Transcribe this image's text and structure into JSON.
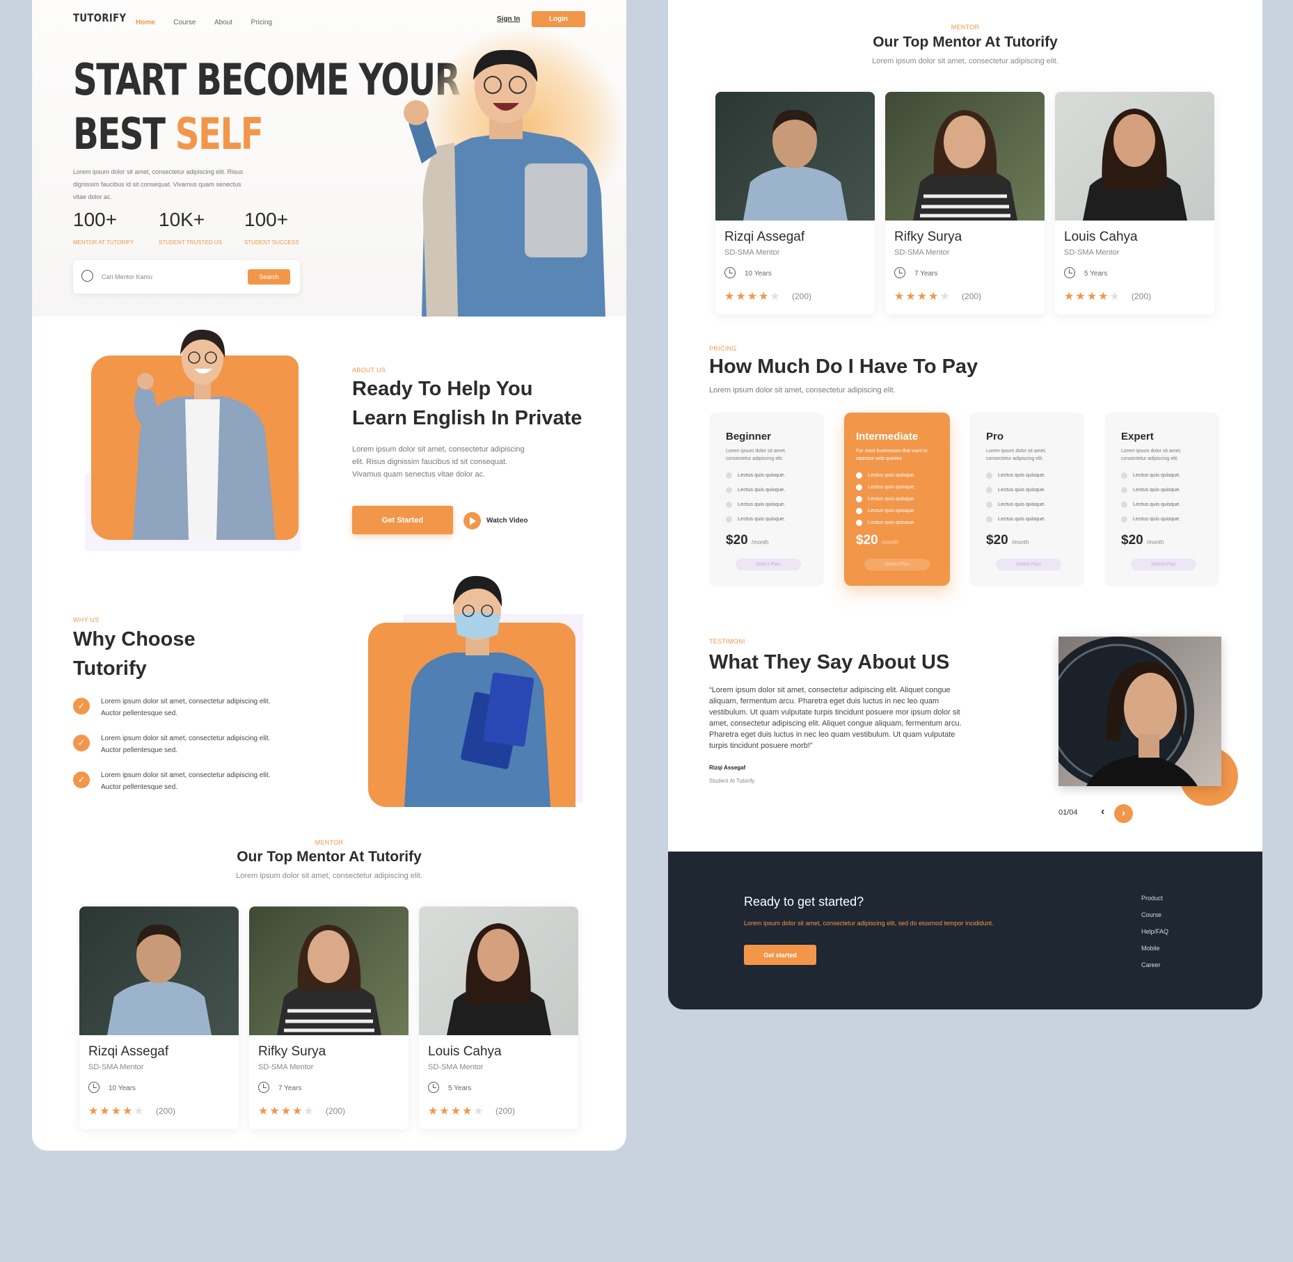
{
  "brand": "TUTORIFY",
  "nav": {
    "items": [
      "Home",
      "Course",
      "About",
      "Pricing"
    ],
    "signin": "Sign In",
    "login": "Login"
  },
  "hero": {
    "title_line1": "START BECOME YOUR",
    "title_line2a": "BEST ",
    "title_line2b": "SELF",
    "desc": "Lorem ipsum dolor sit amet, consectetur adipiscing elit. Risus dignissim faucibus id sit consequat. Vivamus quam senectus vitae dolor ac.",
    "stats": [
      {
        "value": "100+",
        "label": "MENTOR AT TUTORIFY"
      },
      {
        "value": "10K+",
        "label": "STUDENT TRUSTED US"
      },
      {
        "value": "100+",
        "label": "STUDENT SUCCESS"
      }
    ],
    "search_placeholder": "Cari Mentor Kamu",
    "search_button": "Search"
  },
  "about": {
    "eyebrow": "ABOUT US",
    "title_line1": "Ready To Help You",
    "title_line2": "Learn English In Private",
    "desc": "Lorem ipsum dolor sit amet, consectetur adipiscing elit. Risus dignissim faucibus id sit consequat. Vivamus quam senectus vitae dolor ac.",
    "cta": "Get Started",
    "video": "Watch Video"
  },
  "why": {
    "eyebrow": "WHY US",
    "title_line1": "Why Choose",
    "title_line2": "Tutorify",
    "items": [
      {
        "l1": "Lorem ipsum dolor sit amet, consectetur adipiscing elit.",
        "l2": "Auctor pellentesque sed."
      },
      {
        "l1": "Lorem ipsum dolor sit amet, consectetur adipiscing elit.",
        "l2": "Auctor pellentesque sed."
      },
      {
        "l1": "Lorem ipsum dolor sit amet, consectetur adipiscing elit.",
        "l2": "Auctor pellentesque sed."
      }
    ]
  },
  "mentor": {
    "eyebrow": "MENTOR",
    "title": "Our Top Mentor At Tutorify",
    "subtitle": "Lorem ipsum dolor sit amet, consectetur adipiscing elit.",
    "cards": [
      {
        "name": "Rizqi Assegaf",
        "role": "SD-SMA Mentor",
        "years": "10 Years",
        "rating": 4,
        "reviews": "(200)"
      },
      {
        "name": "Rifky Surya",
        "role": "SD-SMA Mentor",
        "years": "7 Years",
        "rating": 4,
        "reviews": "(200)"
      },
      {
        "name": "Louis Cahya",
        "role": "SD-SMA Mentor",
        "years": "5 Years",
        "rating": 4,
        "reviews": "(200)"
      }
    ]
  },
  "pricing": {
    "eyebrow": "PRICING",
    "title": "How Much Do I Have To Pay",
    "subtitle": "Lorem ipsum dolor sit amet, consectetur adipiscing elit.",
    "plans": [
      {
        "name": "Beginner",
        "desc": "Lorem ipsum dolor sit amet, consectetur adipiscing elit.",
        "features": [
          "Lectus quis quisque.",
          "Lectus quis quisque.",
          "Lectus quis quisque.",
          "Lectus quis quisque."
        ],
        "price": "$20",
        "per": "/month",
        "button": "Select Plan"
      },
      {
        "name": "Intermediate",
        "desc": "For most businesses that want to otpimize web queries",
        "features": [
          "Lectus quis quisque.",
          "Lectus quis quisque.",
          "Lectus quis quisque.",
          "Lectus quis quisque.",
          "Lectus quis quisque."
        ],
        "price": "$20",
        "per": "/month",
        "button": "Select Plan"
      },
      {
        "name": "Pro",
        "desc": "Lorem ipsum dolor sit amet, consectetur adipiscing elit.",
        "features": [
          "Lectus quis quisque.",
          "Lectus quis quisque.",
          "Lectus quis quisque.",
          "Lectus quis quisque."
        ],
        "price": "$20",
        "per": "/month",
        "button": "Select Plan"
      },
      {
        "name": "Expert",
        "desc": "Lorem ipsum dolor sit amet, consectetur adipiscing elit.",
        "features": [
          "Lectus quis quisque.",
          "Lectus quis quisque.",
          "Lectus quis quisque.",
          "Lectus quis quisque."
        ],
        "price": "$20",
        "per": "/month",
        "button": "Select Plan"
      }
    ]
  },
  "testimoni": {
    "eyebrow": "TESTIMONI",
    "title": "What They Say About US",
    "quote": "“Lorem ipsum dolor sit amet, consectetur adipiscing elit. Aliquet congue aliquam, fermentum arcu. Pharetra eget duis luctus in nec leo quam vestibulum. Ut quam vulputate turpis tincidunt posuere mor ipsum dolor sit amet, consectetur adipiscing elit. Aliquet congue aliquam, fermentum arcu. Pharetra eget duis luctus in nec leo quam vestibulum. Ut quam vulputate turpis tincidunt posuere morb!”",
    "author": "Rizqi Assegaf",
    "author_role": "Student At Tutorify",
    "pager": "01/04"
  },
  "footer": {
    "title": "Ready to get started?",
    "desc": "Lorem ipsum dolor sit amet, consectetur adipiscing elit, sed do eiusmod tempor incididunt.",
    "cta": "Get started",
    "links": [
      "Product",
      "Course",
      "Help/FAQ",
      "Mobile",
      "Career"
    ]
  },
  "colors": {
    "accent": "#f2964a",
    "dark": "#1f2732",
    "background": "#c9d3e0"
  }
}
